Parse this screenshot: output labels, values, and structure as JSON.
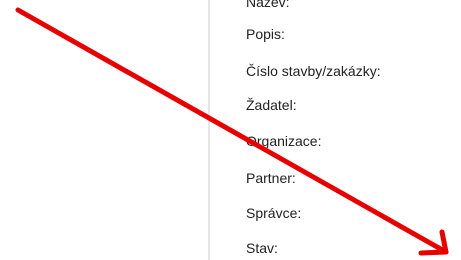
{
  "form": {
    "fields": [
      {
        "label": "Název:"
      },
      {
        "label": "Popis:"
      },
      {
        "label": "Číslo stavby/zakázky:"
      },
      {
        "label": "Žadatel:"
      },
      {
        "label": "Organizace:"
      },
      {
        "label": "Partner:"
      },
      {
        "label": "Správce:"
      },
      {
        "label": "Stav:"
      }
    ]
  },
  "annotation": {
    "arrow_color": "#e60000"
  }
}
